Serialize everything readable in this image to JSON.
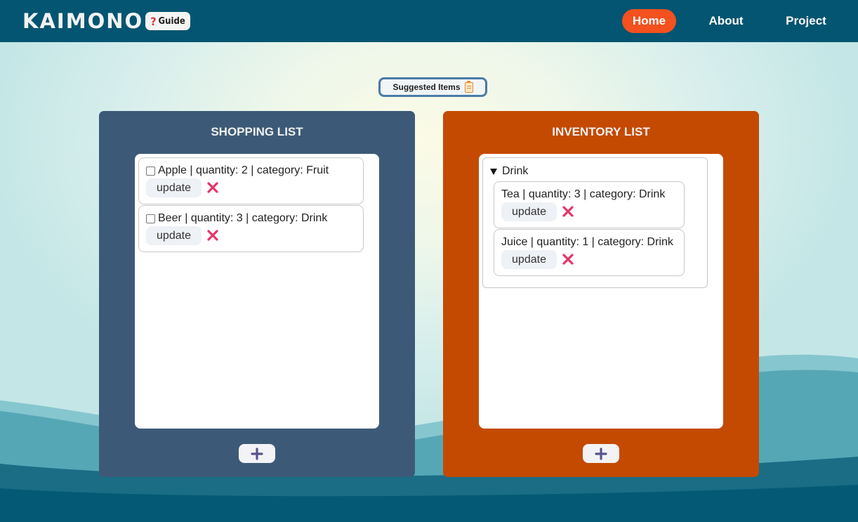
{
  "navbar": {
    "logo": "KAIMONO",
    "guide_label": "Guide",
    "links": [
      {
        "label": "Home",
        "active": true
      },
      {
        "label": "About"
      },
      {
        "label": "Project"
      }
    ]
  },
  "suggested": {
    "label": "Suggested Items"
  },
  "shopping": {
    "title": "SHOPPING LIST",
    "items": [
      {
        "text": "Apple | quantity: 2 | category: Fruit",
        "checked": false,
        "update_label": "update"
      },
      {
        "text": "Beer | quantity: 3 | category: Drink",
        "checked": false,
        "update_label": "update"
      }
    ]
  },
  "inventory": {
    "title": "INVENTORY LIST",
    "groups": [
      {
        "name": "Drink",
        "items": [
          {
            "text": "Tea | quantity: 3 | category: Drink",
            "update_label": "update"
          },
          {
            "text": "Juice | quantity: 1 | category: Drink",
            "update_label": "update"
          }
        ]
      }
    ]
  },
  "colors": {
    "nav_bg": "#045571",
    "home_active": "#f4511e",
    "shopping_panel": "#3c5a77",
    "inventory_panel": "#c44a02",
    "delete_icon": "#e8336b",
    "add_icon": "#56538f"
  }
}
